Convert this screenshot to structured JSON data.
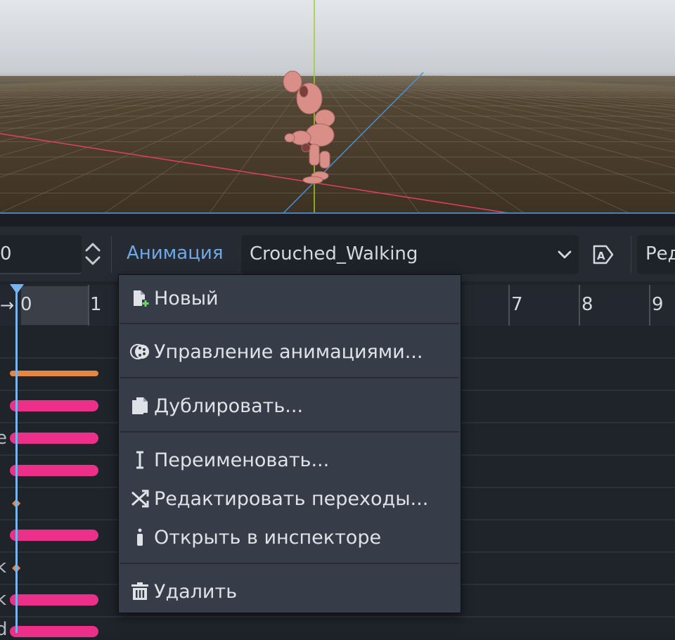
{
  "toolbar": {
    "time_value": "0",
    "animation_label": "Анимация",
    "animation_selected": "Crouched_Walking",
    "edit_label": "Ред"
  },
  "timeline": {
    "ruler_labels": [
      "0",
      "1",
      "7",
      "8",
      "9"
    ],
    "track_name_fragments": [
      "e",
      "k",
      "k",
      "d"
    ]
  },
  "menu": {
    "items": [
      {
        "label": "Новый",
        "icon": "new-file-icon"
      },
      {
        "label": "Управление анимациями...",
        "icon": "animation-library-icon"
      },
      {
        "label": "Дублировать...",
        "icon": "duplicate-icon"
      },
      {
        "label": "Переименовать...",
        "icon": "rename-icon"
      },
      {
        "label": "Редактировать переходы...",
        "icon": "transitions-icon"
      },
      {
        "label": "Открыть в инспекторе",
        "icon": "inspector-icon"
      },
      {
        "label": "Удалить",
        "icon": "trash-icon"
      }
    ]
  },
  "colors": {
    "accent": "#6fa8e6",
    "track_pink": "#ec2f88",
    "track_orange": "#e58742",
    "playhead": "#7db3ec"
  }
}
